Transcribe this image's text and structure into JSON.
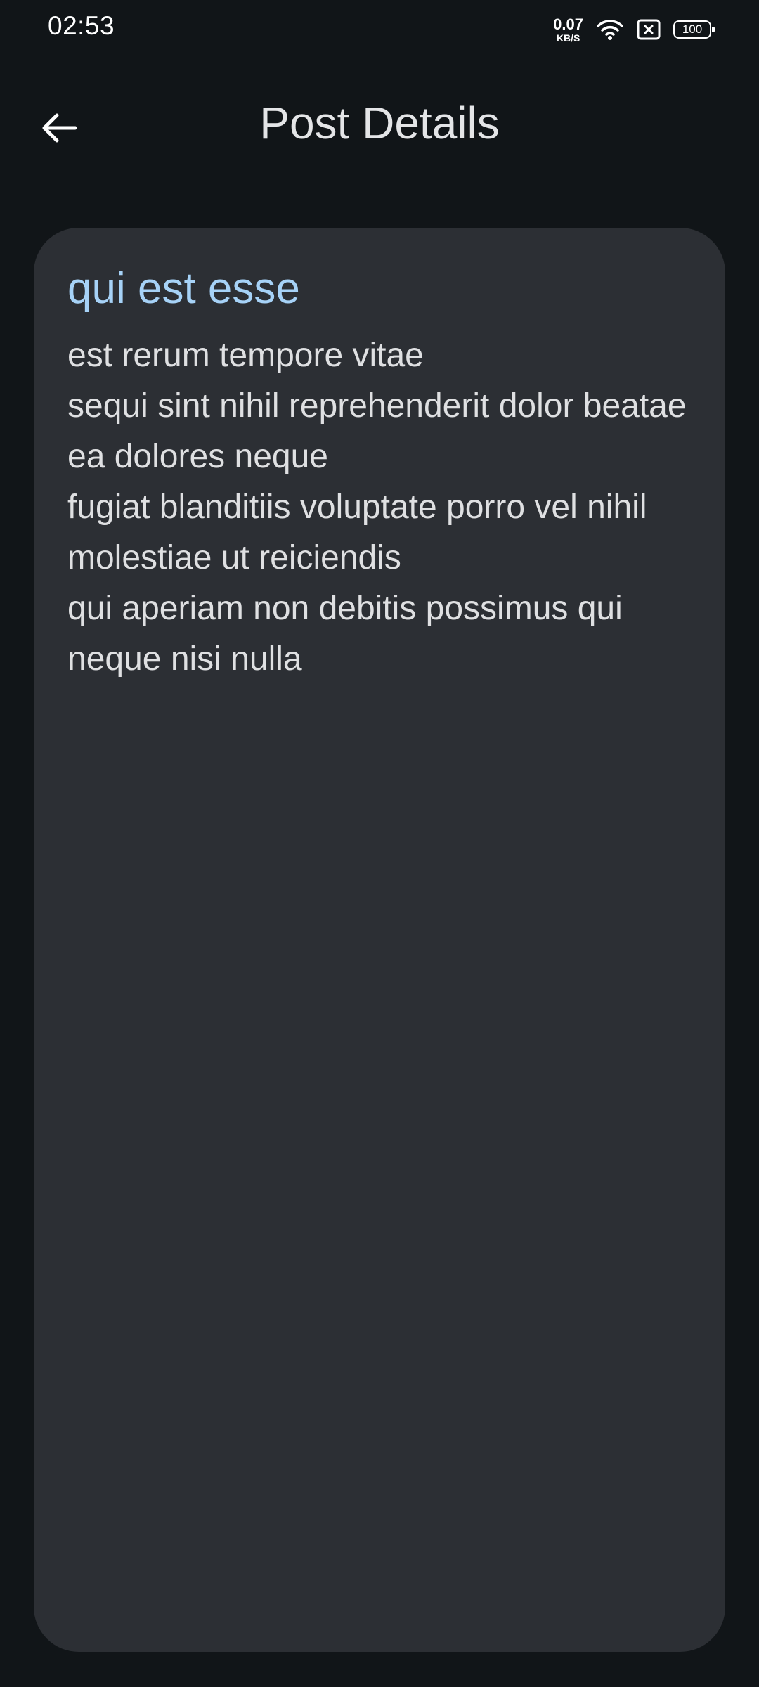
{
  "status_bar": {
    "time": "02:53",
    "net_speed_value": "0.07",
    "net_speed_unit": "KB/S",
    "icons": [
      "wifi-icon",
      "sim-disabled-icon",
      "battery-icon"
    ],
    "battery_level": "100"
  },
  "app_bar": {
    "back_icon": "arrow-left-icon",
    "title": "Post Details"
  },
  "post": {
    "title": "qui est esse",
    "body": "est rerum tempore vitae\nsequi sint nihil reprehenderit dolor beatae ea dolores neque\nfugiat blanditiis voluptate porro vel nihil molestiae ut reiciendis\nqui aperiam non debitis possimus qui neque nisi nulla"
  },
  "colors": {
    "background": "#111518",
    "card": "#2c2f34",
    "title_accent": "#a6d2f7",
    "text": "#dfe0e2"
  }
}
